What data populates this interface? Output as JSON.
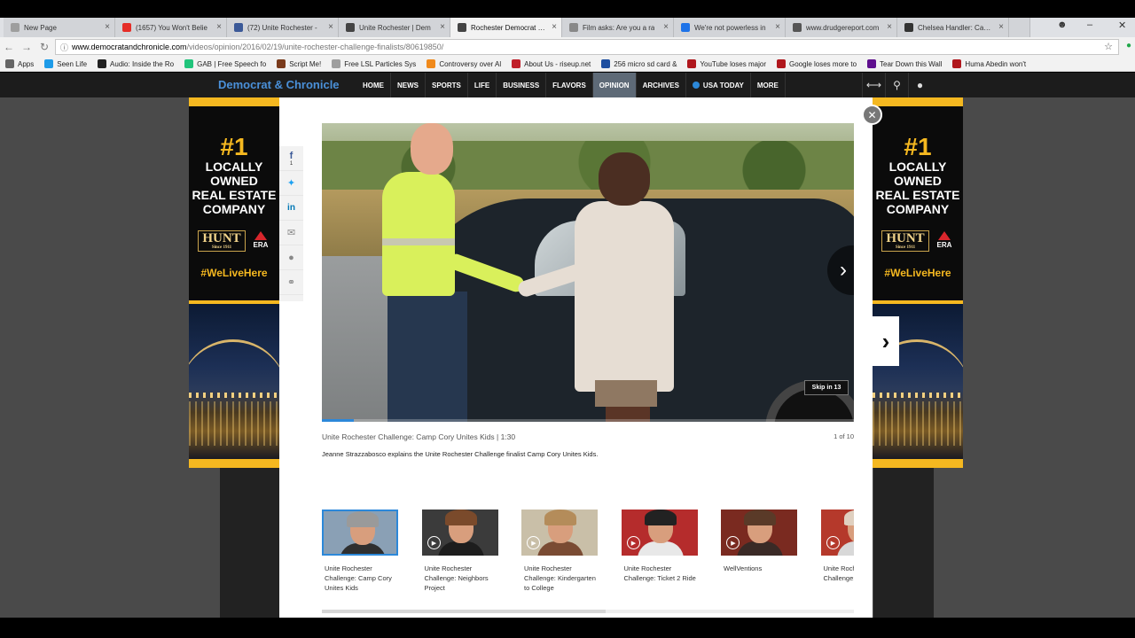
{
  "browser": {
    "tabs": [
      {
        "label": "New Page",
        "icon": "page-icon",
        "color": "#9e9e9e"
      },
      {
        "label": "(1657) You Won't Belie",
        "icon": "youtube-icon",
        "color": "#e52d27"
      },
      {
        "label": "(72) Unite Rochester - ",
        "icon": "facebook-icon",
        "color": "#3b5998"
      },
      {
        "label": "Unite Rochester | Dem",
        "icon": "dc-icon",
        "color": "#444444"
      },
      {
        "label": "Rochester Democrat an",
        "icon": "dc-icon",
        "color": "#444444"
      },
      {
        "label": "Film asks: Are you a ra",
        "icon": "loading-icon",
        "color": "#888888"
      },
      {
        "label": "We're not powerless in",
        "icon": "loading-icon",
        "color": "#1e73e8"
      },
      {
        "label": "www.drudgereport.com",
        "icon": "drudge-icon",
        "color": "#555555"
      },
      {
        "label": "Chelsea Handler: Can W",
        "icon": "news-icon",
        "color": "#333333"
      }
    ],
    "active_tab_index": 4,
    "url_host": "www.democratandchronicle.com",
    "url_path": "/videos/opinion/2016/02/19/unite-rochester-challenge-finalists/80619850/",
    "bookmarks": [
      {
        "label": "Apps",
        "icon": "apps-grid-icon",
        "color": "#666666"
      },
      {
        "label": "Seen Life",
        "icon": "s-icon",
        "color": "#1e9be8"
      },
      {
        "label": "Audio: Inside the Ro",
        "icon": "t-icon",
        "color": "#222222"
      },
      {
        "label": "GAB | Free Speech fo",
        "icon": "frog-icon",
        "color": "#21c47b"
      },
      {
        "label": "Script Me!",
        "icon": "script-icon",
        "color": "#7a3b1c"
      },
      {
        "label": "Free LSL Particles Sys",
        "icon": "page-icon",
        "color": "#9e9e9e"
      },
      {
        "label": "Controversy over Al",
        "icon": "ihe-icon",
        "color": "#f08a1c"
      },
      {
        "label": "About Us - riseup.net",
        "icon": "star-red-icon",
        "color": "#c0202a"
      },
      {
        "label": "256 micro sd card &",
        "icon": "house-icon",
        "color": "#1e4fa0"
      },
      {
        "label": "YouTube loses major",
        "icon": "bookmark-red-icon",
        "color": "#b0171d"
      },
      {
        "label": "Google loses more to",
        "icon": "bookmark-red-icon",
        "color": "#b0171d"
      },
      {
        "label": "Tear Down this Wall",
        "icon": "yahoo-icon",
        "color": "#5f0f8e"
      },
      {
        "label": "Huma Abedin won't",
        "icon": "bookmark-red-icon",
        "color": "#b0171d"
      }
    ]
  },
  "site": {
    "brand": "Democrat & Chronicle",
    "nav": [
      "HOME",
      "NEWS",
      "SPORTS",
      "LIFE",
      "BUSINESS",
      "FLAVORS",
      "OPINION",
      "ARCHIVES",
      "USA TODAY",
      "MORE"
    ],
    "active_nav": "OPINION"
  },
  "ad": {
    "number": "#1",
    "headline": "LOCALLY\nOWNED\nREAL ESTATE\nCOMPANY",
    "brand_hunt": "HUNT",
    "brand_hunt_since": "Since 1911",
    "brand_era": "ERA",
    "hashtag": "#WeLiveHere"
  },
  "share": {
    "facebook_count": "1",
    "items": [
      "facebook-icon",
      "twitter-icon",
      "linkedin-icon",
      "email-icon",
      "comment-icon",
      "link-icon"
    ]
  },
  "video": {
    "title": "Unite Rochester Challenge: Camp Cory Unites Kids | 1:30",
    "counter": "1 of 10",
    "description": "Jeanne Strazzabosco explains the Unite Rochester Challenge finalist Camp Cory Unites Kids.",
    "skip_label": "Skip in 13",
    "progress": 0.06
  },
  "thumbnails": [
    {
      "caption": "Unite Rochester Challenge: Camp Cory Unites Kids",
      "selected": true,
      "bg": "#8aa0b5",
      "hair": "#9a9a9a",
      "body": "#2f2f2f"
    },
    {
      "caption": "Unite Rochester Challenge: Neighbors Project",
      "selected": false,
      "bg": "#3b3b3b",
      "hair": "#7a4a2b",
      "body": "#1d1d1d"
    },
    {
      "caption": "Unite Rochester Challenge: Kindergarten to College",
      "selected": false,
      "bg": "#c9bfa8",
      "hair": "#b48c5a",
      "body": "#7a4b33"
    },
    {
      "caption": "Unite Rochester Challenge: Ticket 2 Ride",
      "selected": false,
      "bg": "#b52c2c",
      "hair": "#222222",
      "body": "#e8e8e8"
    },
    {
      "caption": "WellVentions",
      "selected": false,
      "bg": "#7a2a20",
      "hair": "#5a3a28",
      "body": "#3a2a26"
    },
    {
      "caption": "Unite Rochester Challenge: Healthy Fit",
      "selected": false,
      "bg": "#b5392b",
      "hair": "#e0d0c0",
      "body": "#d8d8d8"
    }
  ]
}
